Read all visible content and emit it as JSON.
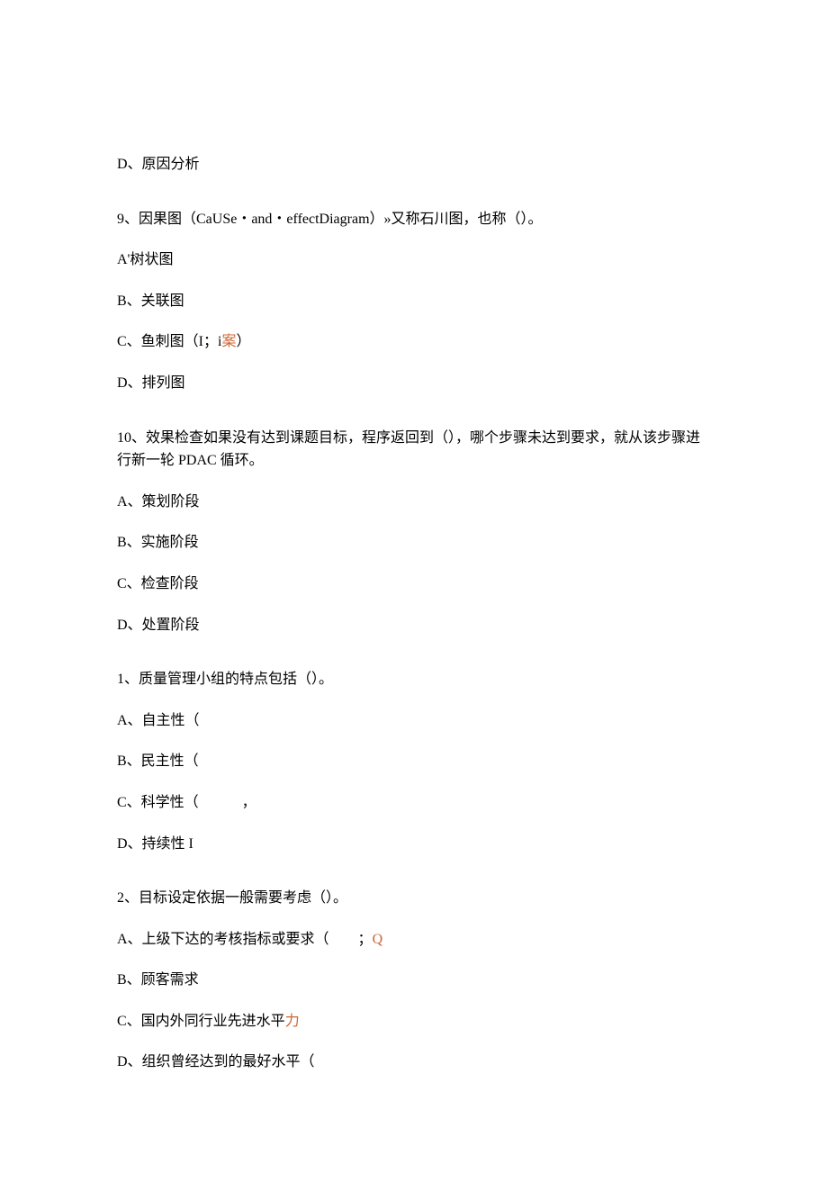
{
  "q8": {
    "optionD": "D、原因分析"
  },
  "q9": {
    "text": "9、因果图（CaUSe・and・effectDiagram）»又称石川图，也称（）。",
    "optionA": "A'树状图",
    "optionB": "B、关联图",
    "optionC_prefix": "C、鱼刺图（I；i",
    "optionC_hl": "案",
    "optionC_suffix": "）",
    "optionD": "D、排列图"
  },
  "q10": {
    "text": "10、效果检查如果没有达到课题目标，程序返回到（），哪个步骤未达到要求，就从该步骤进行新一轮 PDAC 循环。",
    "optionA": "A、策划阶段",
    "optionB": "B、实施阶段",
    "optionC": "C、检查阶段",
    "optionD": "D、处置阶段"
  },
  "qm1": {
    "text": "1、质量管理小组的特点包括（）。",
    "optionA": "A、自主性（",
    "optionB": "B、民主性（",
    "optionC": "C、科学性（　　　，",
    "optionD": "D、持续性 I"
  },
  "qm2": {
    "text": "2、目标设定依据一般需要考虑（）。",
    "optionA_prefix": "A、上级下达的考核指标或要求（　　；",
    "optionA_hl": "Q",
    "optionB": "B、顾客需求",
    "optionC_prefix": "C、国内外同行业先进水平",
    "optionC_hl": "力",
    "optionD": "D、组织曾经达到的最好水平（"
  }
}
